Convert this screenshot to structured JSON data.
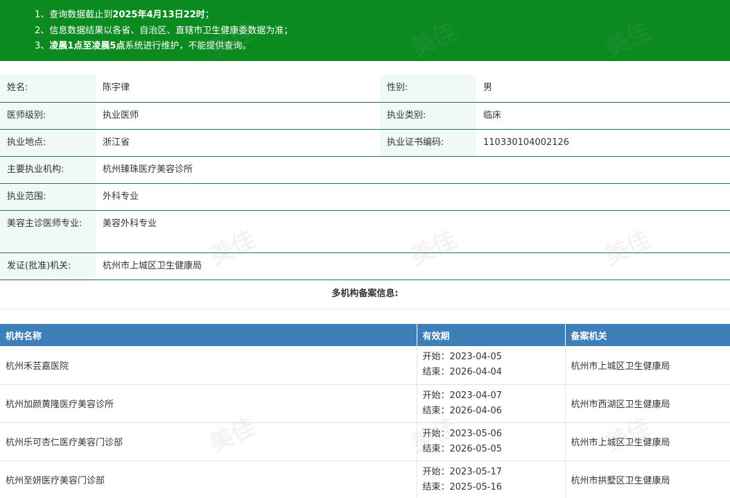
{
  "notice": {
    "lines": [
      {
        "prefix": "1、查询数据截止到",
        "bold": "2025年4月13日22时",
        "suffix": "；"
      },
      {
        "prefix": "2、信息数据结果以各省、自治区、直辖市卫生健康委数据为准；",
        "bold": "",
        "suffix": ""
      },
      {
        "prefix": "3、",
        "bold": "凌晨1点至凌晨5点",
        "suffix": "系统进行维护，不能提供查询。"
      }
    ]
  },
  "doctor": {
    "name_label": "姓名:",
    "name": "陈宇律",
    "gender_label": "性别:",
    "gender": "男",
    "level_label": "医师级别:",
    "level": "执业医师",
    "category_label": "执业类别:",
    "category": "临床",
    "location_label": "执业地点:",
    "location": "浙江省",
    "cert_label": "执业证书编码:",
    "cert_no": "110330104002126",
    "institution_label": "主要执业机构:",
    "institution": "杭州臻珠医疗美容诊所",
    "scope_label": "执业范围:",
    "scope": "外科专业",
    "cosmetic_label": "美容主诊医师专业:",
    "cosmetic": "美容外科专业",
    "issuer_label": "发证(批准)机关:",
    "issuer": "杭州市上城区卫生健康局"
  },
  "multi": {
    "title": "多机构备案信息:",
    "headers": {
      "org": "机构名称",
      "period": "有效期",
      "agency": "备案机关"
    },
    "rows": [
      {
        "org": "杭州禾芸嘉医院",
        "start": "开始：2023-04-05",
        "end": "结束：2026-04-04",
        "agency": "杭州市上城区卫生健康局"
      },
      {
        "org": "杭州加颜黄隆医疗美容诊所",
        "start": "开始：2023-04-07",
        "end": "结束：2026-04-06",
        "agency": "杭州市西湖区卫生健康局"
      },
      {
        "org": "杭州乐可杏仁医疗美容门诊部",
        "start": "开始：2023-05-06",
        "end": "结束：2026-05-05",
        "agency": "杭州市上城区卫生健康局"
      },
      {
        "org": "杭州至妍医疗美容门诊部",
        "start": "开始：2023-05-17",
        "end": "结束：2025-05-16",
        "agency": "杭州市拱墅区卫生健康局"
      }
    ]
  },
  "watermark": {
    "text": "美佳"
  },
  "colors": {
    "notice_bg": "#0a8a1f",
    "label_bg": "#eefaf3",
    "header_bg": "#3d7fb8",
    "row_border": "#2e6b5a"
  }
}
